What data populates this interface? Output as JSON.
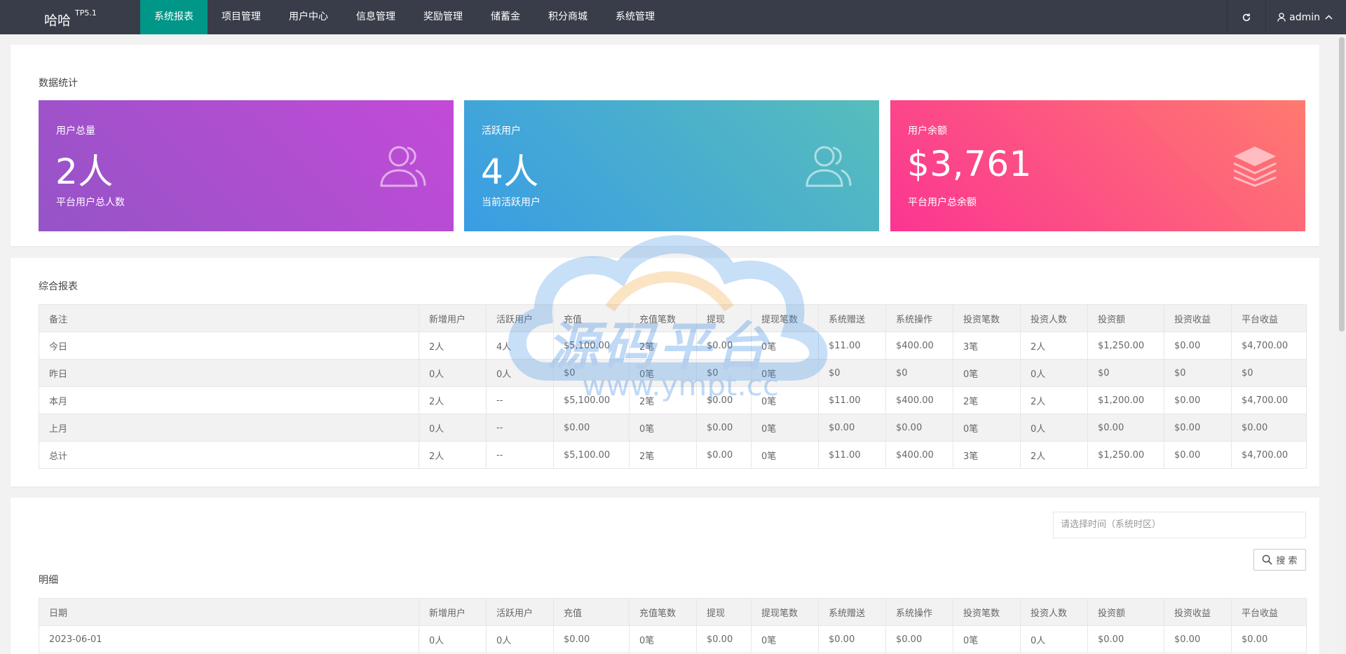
{
  "app": {
    "logo": "哈哈",
    "version": "TP5.1"
  },
  "nav": {
    "items": [
      "系统报表",
      "项目管理",
      "用户中心",
      "信息管理",
      "奖励管理",
      "储蓄金",
      "积分商城",
      "系统管理"
    ],
    "active_index": 0
  },
  "user": {
    "name": "admin"
  },
  "icons": {
    "refresh": "refresh-icon",
    "user": "user-icon",
    "chevron": "chevron-up-icon",
    "users": "users-icon",
    "layers": "layers-icon",
    "search": "search-icon"
  },
  "stats": {
    "title": "数据统计",
    "cards": [
      {
        "label": "用户总量",
        "value": "2人",
        "desc": "平台用户总人数"
      },
      {
        "label": "活跃用户",
        "value": "4人",
        "desc": "当前活跃用户"
      },
      {
        "label": "用户余额",
        "value": "$3,761",
        "desc": "平台用户总余额"
      }
    ]
  },
  "report": {
    "title": "综合报表",
    "headers": [
      "备注",
      "新增用户",
      "活跃用户",
      "充值",
      "充值笔数",
      "提现",
      "提现笔数",
      "系统赠送",
      "系统操作",
      "投资笔数",
      "投资人数",
      "投资额",
      "投资收益",
      "平台收益"
    ],
    "rows": [
      [
        "今日",
        "2人",
        "4人",
        "$5,100.00",
        "2笔",
        "$0.00",
        "0笔",
        "$11.00",
        "$400.00",
        "3笔",
        "2人",
        "$1,250.00",
        "$0.00",
        "$4,700.00"
      ],
      [
        "昨日",
        "0人",
        "0人",
        "$0",
        "0笔",
        "$0",
        "0笔",
        "$0",
        "$0",
        "0笔",
        "0人",
        "$0",
        "$0",
        "$0"
      ],
      [
        "本月",
        "2人",
        "--",
        "$5,100.00",
        "2笔",
        "$0.00",
        "0笔",
        "$11.00",
        "$400.00",
        "2笔",
        "2人",
        "$1,200.00",
        "$0.00",
        "$4,700.00"
      ],
      [
        "上月",
        "0人",
        "--",
        "$0.00",
        "0笔",
        "$0.00",
        "0笔",
        "$0.00",
        "$0.00",
        "0笔",
        "0人",
        "$0.00",
        "$0.00",
        "$0.00"
      ],
      [
        "总计",
        "2人",
        "--",
        "$5,100.00",
        "2笔",
        "$0.00",
        "0笔",
        "$11.00",
        "$400.00",
        "3笔",
        "2人",
        "$1,250.00",
        "$0.00",
        "$4,700.00"
      ]
    ]
  },
  "detail": {
    "title": "明细",
    "date_placeholder": "请选择时间（系统时区）",
    "search_label": "搜 索",
    "headers": [
      "日期",
      "新增用户",
      "活跃用户",
      "充值",
      "充值笔数",
      "提现",
      "提现笔数",
      "系统赠送",
      "系统操作",
      "投资笔数",
      "投资人数",
      "投资额",
      "投资收益",
      "平台收益"
    ],
    "rows": [
      [
        "2023-06-01",
        "0人",
        "0人",
        "$0.00",
        "0笔",
        "$0.00",
        "0笔",
        "$0.00",
        "$0.00",
        "0笔",
        "0人",
        "$0.00",
        "$0.00",
        "$0.00"
      ]
    ]
  },
  "watermark": {
    "text": "源码平台",
    "url": "www.ympt.cc"
  },
  "colors": {
    "nav_bg": "#393d49",
    "nav_active": "#009688"
  }
}
